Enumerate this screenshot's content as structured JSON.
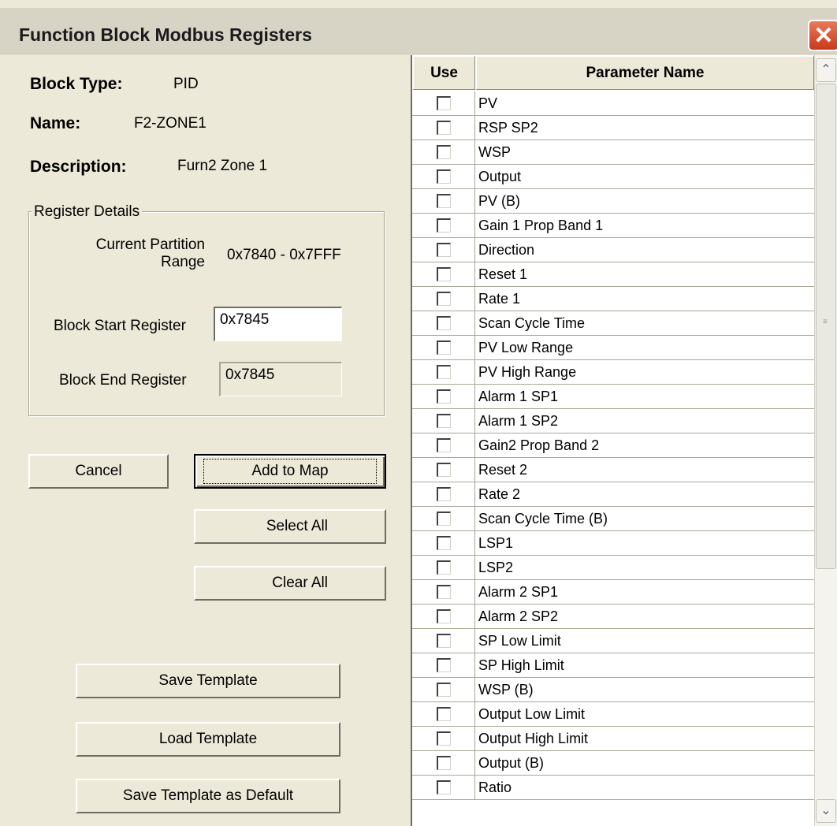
{
  "window": {
    "title": "Function Block Modbus Registers",
    "close_glyph": "✕"
  },
  "info": {
    "block_type_label": "Block Type:",
    "block_type_value": "PID",
    "name_label": "Name:",
    "name_value": "F2-ZONE1",
    "description_label": "Description:",
    "description_value": "Furn2 Zone 1"
  },
  "register_details": {
    "legend": "Register Details",
    "partition_label_line1": "Current Partition",
    "partition_label_line2": "Range",
    "partition_value": "0x7840 - 0x7FFF",
    "start_label": "Block Start Register",
    "start_value": "0x7845",
    "end_label": "Block End Register",
    "end_value": "0x7845"
  },
  "buttons": {
    "cancel": "Cancel",
    "add_to_map": "Add to Map",
    "select_all": "Select All",
    "clear_all": "Clear All",
    "save_template": "Save Template",
    "load_template": "Load Template",
    "save_template_default": "Save Template as Default"
  },
  "table": {
    "columns": [
      "Use",
      "Parameter Name"
    ],
    "rows": [
      {
        "name": "PV",
        "checked": false
      },
      {
        "name": "RSP SP2",
        "checked": false
      },
      {
        "name": "WSP",
        "checked": false
      },
      {
        "name": "Output",
        "checked": false
      },
      {
        "name": "PV (B)",
        "checked": false
      },
      {
        "name": "Gain 1 Prop Band 1",
        "checked": false
      },
      {
        "name": "Direction",
        "checked": false
      },
      {
        "name": "Reset 1",
        "checked": false
      },
      {
        "name": "Rate 1",
        "checked": false
      },
      {
        "name": "Scan Cycle Time",
        "checked": false
      },
      {
        "name": "PV Low Range",
        "checked": false
      },
      {
        "name": "PV High Range",
        "checked": false
      },
      {
        "name": "Alarm 1 SP1",
        "checked": false
      },
      {
        "name": "Alarm 1 SP2",
        "checked": false
      },
      {
        "name": "Gain2 Prop Band 2",
        "checked": false
      },
      {
        "name": "Reset 2",
        "checked": false
      },
      {
        "name": "Rate 2",
        "checked": false
      },
      {
        "name": "Scan Cycle Time (B)",
        "checked": false
      },
      {
        "name": "LSP1",
        "checked": false
      },
      {
        "name": "LSP2",
        "checked": false
      },
      {
        "name": "Alarm 2 SP1",
        "checked": false
      },
      {
        "name": "Alarm 2 SP2",
        "checked": false
      },
      {
        "name": "SP Low Limit",
        "checked": false
      },
      {
        "name": "SP High Limit",
        "checked": false
      },
      {
        "name": "WSP (B)",
        "checked": false
      },
      {
        "name": "Output Low Limit",
        "checked": false
      },
      {
        "name": "Output High Limit",
        "checked": false
      },
      {
        "name": "Output (B)",
        "checked": false
      },
      {
        "name": "Ratio",
        "checked": false
      }
    ]
  },
  "scrollbar": {
    "up_glyph": "⌃",
    "down_glyph": "⌄"
  }
}
